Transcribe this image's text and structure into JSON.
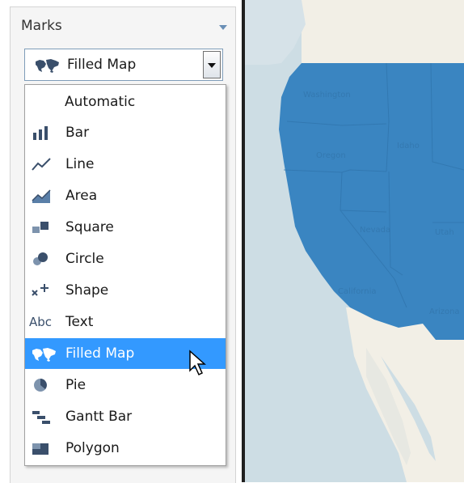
{
  "marks": {
    "title": "Marks",
    "selected_mark": "Filled Map"
  },
  "mark_types": [
    {
      "label": "Automatic",
      "icon": "none"
    },
    {
      "label": "Bar",
      "icon": "bar-chart-icon"
    },
    {
      "label": "Line",
      "icon": "line-chart-icon"
    },
    {
      "label": "Area",
      "icon": "area-chart-icon"
    },
    {
      "label": "Square",
      "icon": "square-icon"
    },
    {
      "label": "Circle",
      "icon": "circle-icon"
    },
    {
      "label": "Shape",
      "icon": "shape-icon"
    },
    {
      "label": "Text",
      "icon": "text-icon",
      "icon_text": "Abc"
    },
    {
      "label": "Filled Map",
      "icon": "filled-map-icon",
      "selected": true
    },
    {
      "label": "Pie",
      "icon": "pie-icon"
    },
    {
      "label": "Gantt Bar",
      "icon": "gantt-bar-icon"
    },
    {
      "label": "Polygon",
      "icon": "polygon-icon"
    }
  ],
  "map": {
    "state_labels": [
      "Washington",
      "Oregon",
      "Idaho",
      "Nevada",
      "Utah",
      "California",
      "Arizona"
    ]
  },
  "colors": {
    "filled_region": "#3a85c1",
    "selection": "#3399ff",
    "land": "#f2efe6",
    "water": "#cddde4"
  }
}
